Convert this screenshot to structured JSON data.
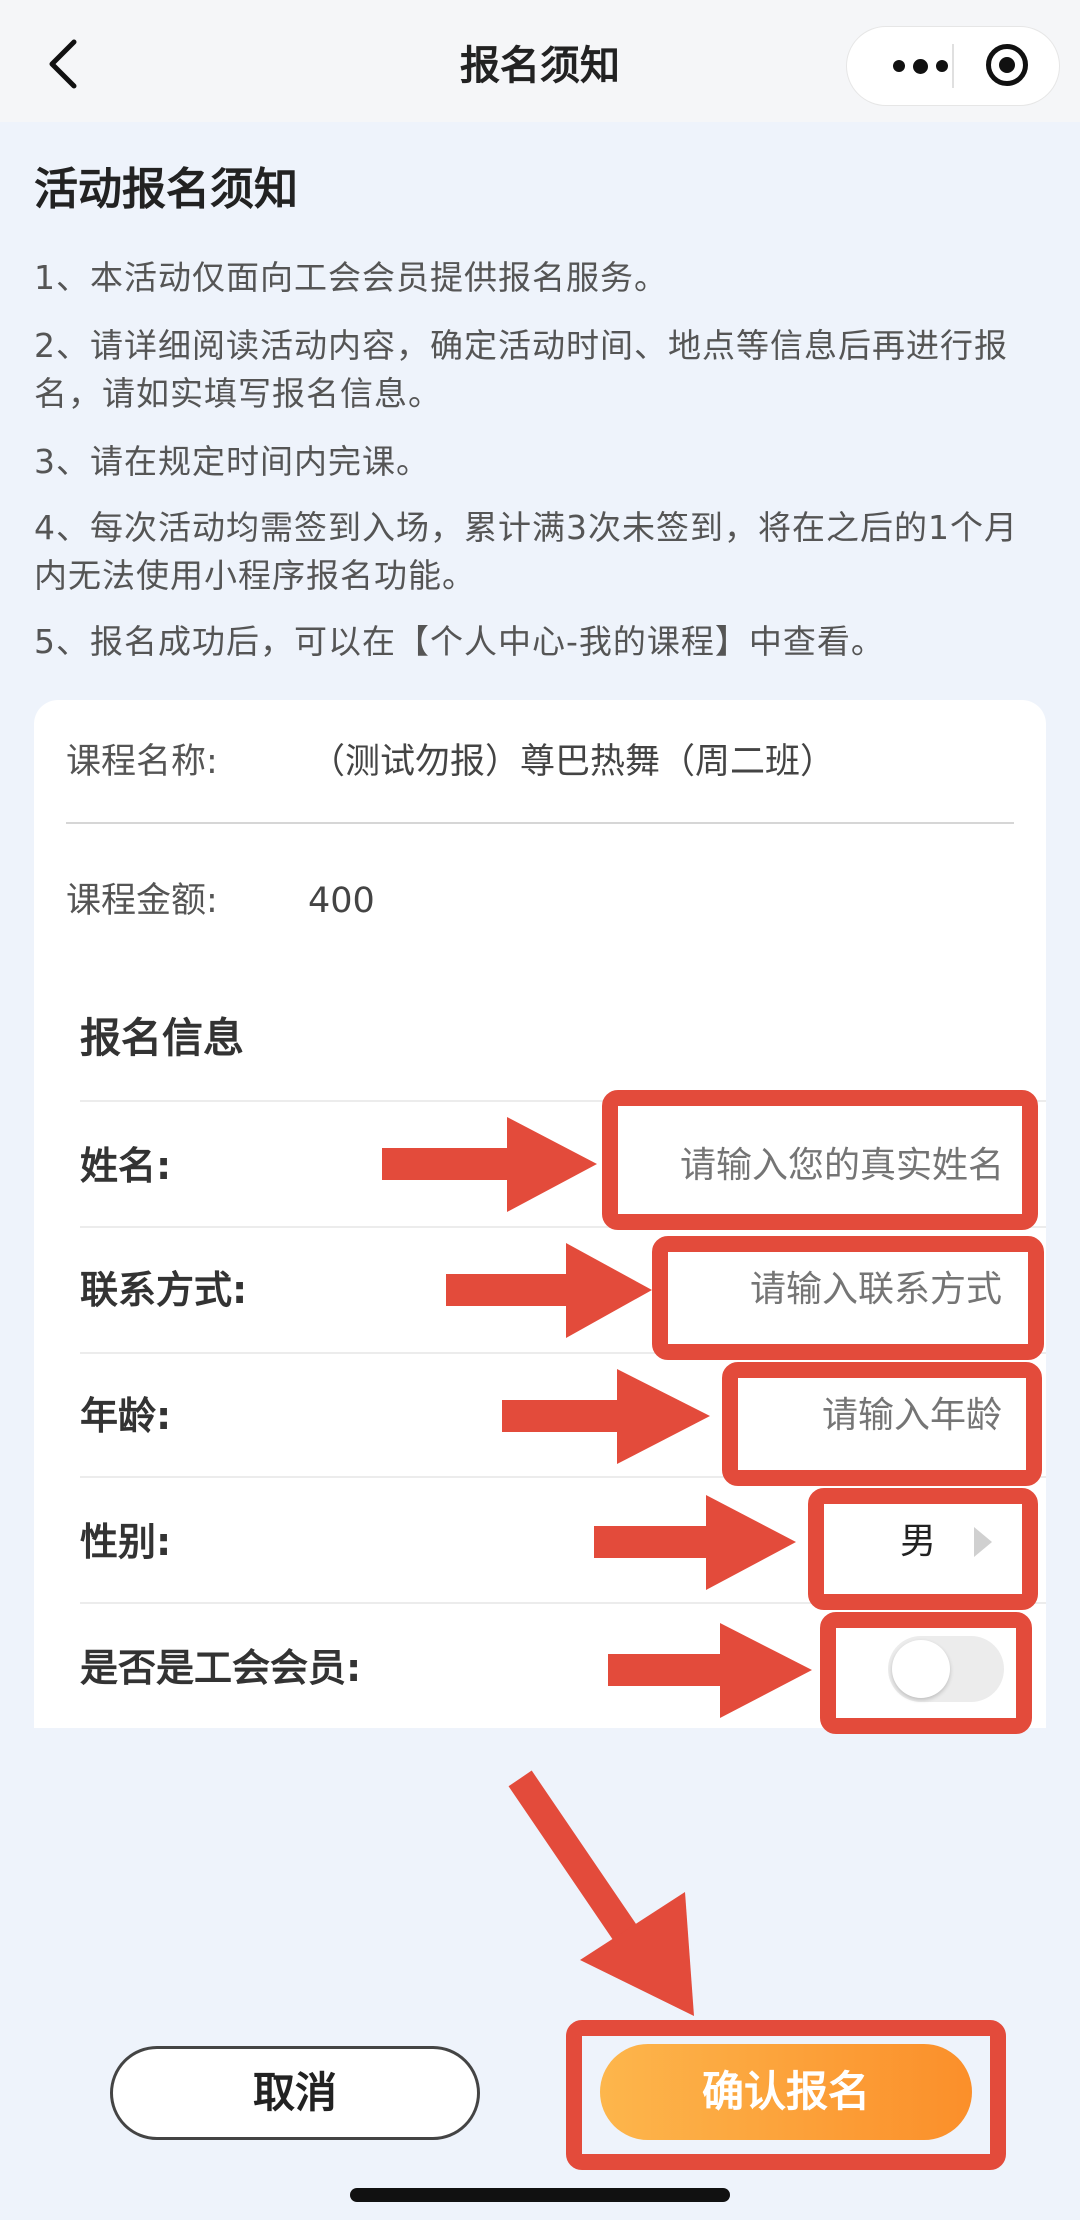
{
  "nav": {
    "title": "报名须知"
  },
  "notice": {
    "title": "活动报名须知",
    "items": [
      "1、本活动仅面向工会会员提供报名服务。",
      "2、请详细阅读活动内容，确定活动时间、地点等信息后再进行报名，请如实填写报名信息。",
      "3、请在规定时间内完课。",
      "4、每次活动均需签到入场，累计满3次未签到，将在之后的1个月内无法使用小程序报名功能。",
      "5、报名成功后，可以在【个人中心-我的课程】中查看。"
    ]
  },
  "course": {
    "name_label": "课程名称:",
    "name_value": "（测试勿报）尊巴热舞（周二班）",
    "price_label": "课程金额:",
    "price_value": "400"
  },
  "form": {
    "title": "报名信息",
    "name_label": "姓名:",
    "name_placeholder": "请输入您的真实姓名",
    "contact_label": "联系方式:",
    "contact_placeholder": "请输入联系方式",
    "age_label": "年龄:",
    "age_placeholder": "请输入年龄",
    "gender_label": "性别:",
    "gender_value": "男",
    "member_label": "是否是工会会员:",
    "member_toggle_on": false
  },
  "buttons": {
    "cancel": "取消",
    "confirm": "确认报名"
  },
  "colors": {
    "accent_orange": "#fb8f2a",
    "annotation_red": "#e34b3b",
    "background": "#eef3fb"
  }
}
